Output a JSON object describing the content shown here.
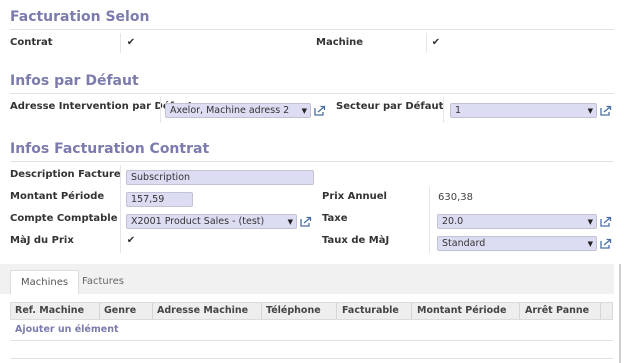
{
  "sections": {
    "billing_mode": {
      "title": "Facturation Selon"
    },
    "defaults": {
      "title": "Infos par Défaut"
    },
    "contract_billing": {
      "title": "Infos Facturation Contrat"
    }
  },
  "billing_mode": {
    "contract_label": "Contrat",
    "contract_checked": true,
    "machine_label": "Machine",
    "machine_checked": true
  },
  "defaults": {
    "address_label": "Adresse Intervention par Défaut",
    "address_value": "Axelor, Machine adress 2",
    "sector_label": "Secteur par Défaut",
    "sector_value": "1"
  },
  "contract_billing": {
    "description_label": "Description Facture",
    "description_value": "Subscription",
    "amount_label": "Montant Période",
    "amount_value": "157,59",
    "annual_price_label": "Prix Annuel",
    "annual_price_value": "630,38",
    "account_label": "Compte Comptable",
    "account_value": "X2001 Product Sales - (test)",
    "tax_label": "Taxe",
    "tax_value": "20.0",
    "price_update_label": "MàJ du Prix",
    "price_update_checked": true,
    "update_rate_label": "Taux de MàJ",
    "update_rate_value": "Standard"
  },
  "tabs": [
    {
      "label": "Machines",
      "active": true
    },
    {
      "label": "Factures",
      "active": false
    }
  ],
  "table": {
    "columns": [
      "Ref. Machine",
      "Genre",
      "Adresse Machine",
      "Téléphone",
      "Facturable",
      "Montant Période",
      "Arrêt Panne"
    ],
    "add_item_label": "Ajouter un élément"
  },
  "icons": {
    "checkbox": "check-icon",
    "dropdown": "caret-down-icon",
    "open_record": "external-link-icon"
  },
  "colors": {
    "accent": "#7c7bad",
    "field_bg": "#dcdcf3",
    "field_border": "#c2c2d6",
    "tab_bar_bg": "#f1f1f1",
    "table_header_bg": "#eeeeee"
  }
}
